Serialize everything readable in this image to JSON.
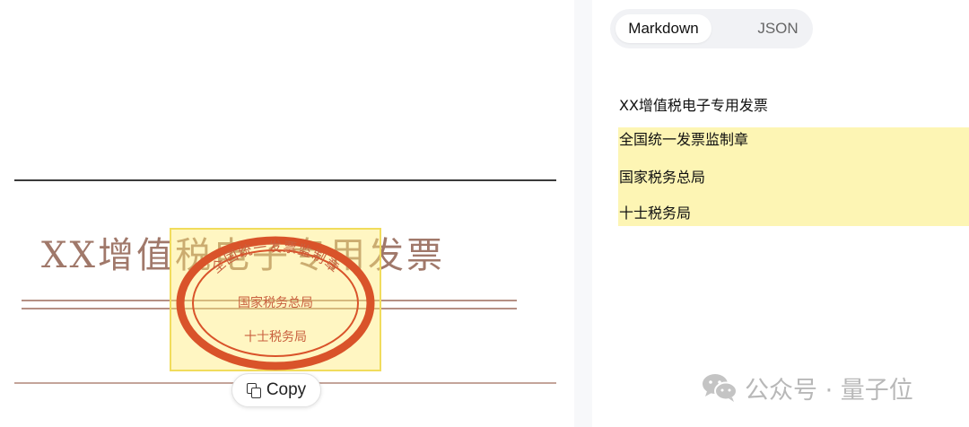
{
  "document": {
    "title": "XX增值税电子专用发票",
    "seal_text": {
      "line1": "全国统一发票监制章",
      "line2": "国家税务总局",
      "line3": "十士税务局"
    }
  },
  "copy_button": {
    "label": "Copy"
  },
  "tabs": [
    {
      "label": "Markdown",
      "active": true
    },
    {
      "label": "JSON",
      "active": false
    }
  ],
  "markdown_output": [
    {
      "text": "XX增值税电子专用发票",
      "highlighted": false
    },
    {
      "text": "全国统一发票监制章",
      "highlighted": true
    },
    {
      "text": "国家税务总局",
      "highlighted": true
    },
    {
      "text": "十士税务局",
      "highlighted": true
    }
  ],
  "watermark": {
    "text": "公众号 · 量子位"
  },
  "colors": {
    "highlight_fill": "#fdf5b4",
    "seal_red": "#d9532a",
    "tab_bg": "#f1f2f5"
  }
}
